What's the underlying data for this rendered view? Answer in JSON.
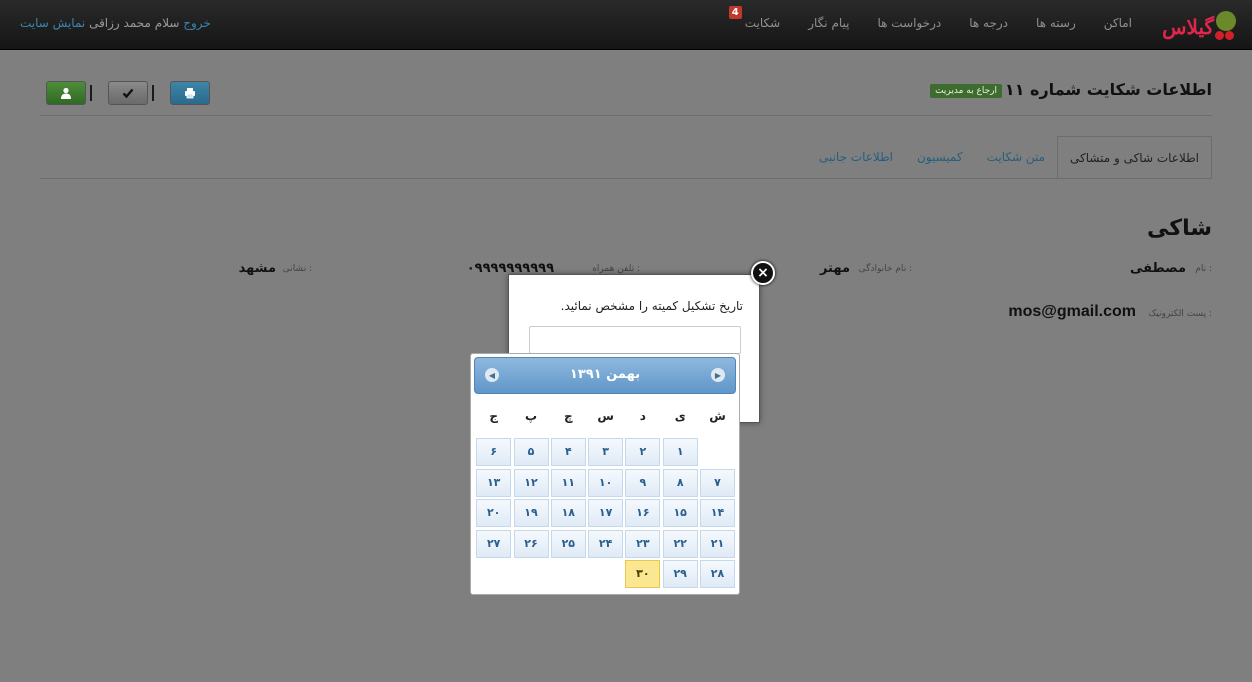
{
  "navbar": {
    "logo_text": "گیلاس",
    "items": [
      {
        "label": "اماکن"
      },
      {
        "label": "رسته ها"
      },
      {
        "label": "درجه ها"
      },
      {
        "label": "درخواست ها"
      },
      {
        "label": "پیام نگار"
      },
      {
        "label": "شکایت",
        "badge": "4"
      }
    ],
    "greeting": "سلام محمد رزاقی",
    "site_link": "نمایش سایت",
    "logout": "خروج"
  },
  "header": {
    "title": "اطلاعات شکایت شماره ۱۱",
    "back_label": "ارجاع به مدیریت"
  },
  "toolbar": {
    "buttons": [
      {
        "icon": "user-icon"
      },
      {
        "icon": "check-icon"
      },
      {
        "icon": "print-icon"
      }
    ]
  },
  "tabs": [
    {
      "label": "اطلاعات شاکی و متشاکی",
      "active": true
    },
    {
      "label": "متن شکایت"
    },
    {
      "label": "کمیسیون"
    },
    {
      "label": "اطلاعات جانبی"
    }
  ],
  "complainant": {
    "section_title": "شاکی",
    "name_label": "نام :",
    "name_value": "مصطفی",
    "family_label": "نام خانوادگی :",
    "family_value": "مهتر",
    "mobile_label": "تلفن همراه :",
    "mobile_value": "۰۹۹۹۹۹۹۹۹۹۹",
    "address_label": "نشانی :",
    "address_value": "مشهد",
    "email_label": "پست الکترونیک :",
    "email_value": "mos@gmail.com"
  },
  "modal": {
    "prompt": "تاریخ تشکیل کمیته را مشخص نمائید.",
    "input_value": "",
    "close_label": "×"
  },
  "datepicker": {
    "month_title": "بهمن ۱۳۹۱",
    "weekdays": [
      "ش",
      "ی",
      "د",
      "س",
      "چ",
      "پ",
      "ج"
    ],
    "leading_blanks": 1,
    "days": [
      "۱",
      "۲",
      "۳",
      "۴",
      "۵",
      "۶",
      "۷",
      "۸",
      "۹",
      "۱۰",
      "۱۱",
      "۱۲",
      "۱۳",
      "۱۴",
      "۱۵",
      "۱۶",
      "۱۷",
      "۱۸",
      "۱۹",
      "۲۰",
      "۲۱",
      "۲۲",
      "۲۳",
      "۲۴",
      "۲۵",
      "۲۶",
      "۲۷",
      "۲۸",
      "۲۹",
      "۳۰"
    ],
    "today": "۳۰"
  }
}
